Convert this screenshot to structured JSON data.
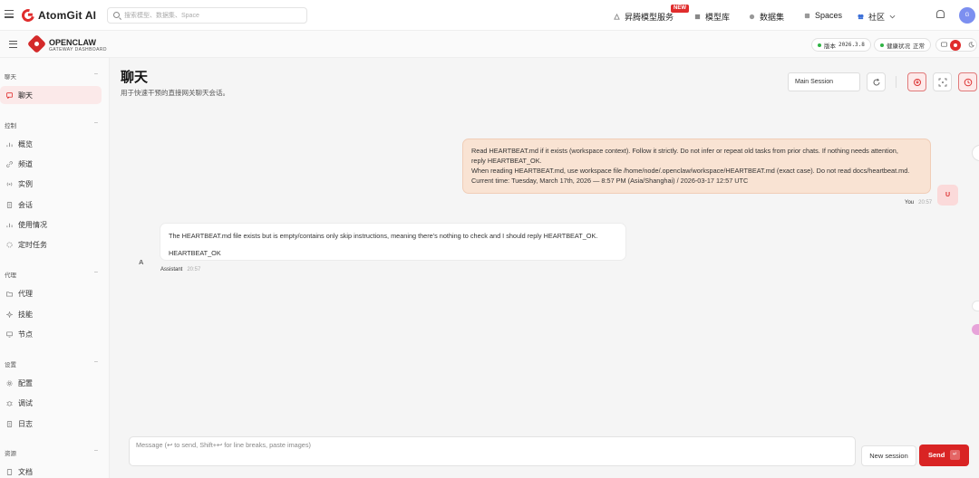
{
  "topbar": {
    "brand": "AtomGit AI",
    "search_placeholder": "搜索模型、数据集、Space",
    "nav": [
      {
        "label": "昇腾模型服务",
        "icon": "ascend-icon"
      },
      {
        "label": "模型库",
        "icon": "model-icon"
      },
      {
        "label": "数据集",
        "icon": "dataset-icon"
      },
      {
        "label": "Spaces",
        "icon": "spaces-icon"
      },
      {
        "label": "社区",
        "icon": "community-icon"
      }
    ],
    "new_badge": "NEW",
    "avatar_initial": "G"
  },
  "gateway": {
    "title": "OPENCLAW",
    "subtitle": "GATEWAY DASHBOARD",
    "version_label": "版本",
    "version_value": "2026.3.8",
    "health_label": "健康状况",
    "health_value": "正常"
  },
  "sidebar": {
    "sections": [
      {
        "title": "聊天",
        "items": [
          {
            "label": "聊天",
            "active": true
          }
        ]
      },
      {
        "title": "控制",
        "items": [
          {
            "label": "概览"
          },
          {
            "label": "频道"
          },
          {
            "label": "实例"
          },
          {
            "label": "会话"
          },
          {
            "label": "使用情况"
          },
          {
            "label": "定时任务"
          }
        ]
      },
      {
        "title": "代理",
        "items": [
          {
            "label": "代理"
          },
          {
            "label": "技能"
          },
          {
            "label": "节点"
          }
        ]
      },
      {
        "title": "设置",
        "items": [
          {
            "label": "配置"
          },
          {
            "label": "调试"
          },
          {
            "label": "日志"
          }
        ]
      },
      {
        "title": "资源",
        "items": [
          {
            "label": "文档"
          }
        ]
      }
    ]
  },
  "chat": {
    "title": "聊天",
    "subtitle": "用于快速干预的直接网关聊天会话。",
    "session": "Main Session",
    "user_message": [
      "Read HEARTBEAT.md if it exists (workspace context). Follow it strictly. Do not infer or repeat old tasks from prior chats. If nothing needs attention,",
      "reply HEARTBEAT_OK.",
      "When reading HEARTBEAT.md, use workspace file /home/node/.openclaw/workspace/HEARTBEAT.md (exact case). Do not read docs/heartbeat.md.",
      "Current time: Tuesday, March 17th, 2026 — 8:57 PM (Asia/Shanghai) / 2026-03-17 12:57 UTC"
    ],
    "user_avatar": "U",
    "user_name": "You",
    "user_time": "20:57",
    "assistant_message": [
      "The HEARTBEAT.md file exists but is empty/contains only skip instructions, meaning there's nothing to check and I should reply HEARTBEAT_OK.",
      "HEARTBEAT_OK"
    ],
    "assistant_avatar": "A",
    "assistant_name": "Assistant",
    "assistant_time": "20:57",
    "composer_placeholder": "Message (↩ to send, Shift+↩ for line breaks, paste images)",
    "new_session_label": "New session",
    "send_label": "Send",
    "send_shortcut": "↵"
  },
  "colors": {
    "accent": "#d92424",
    "user_bubble": "#f9e3d3",
    "status_ok": "#2fb344"
  }
}
